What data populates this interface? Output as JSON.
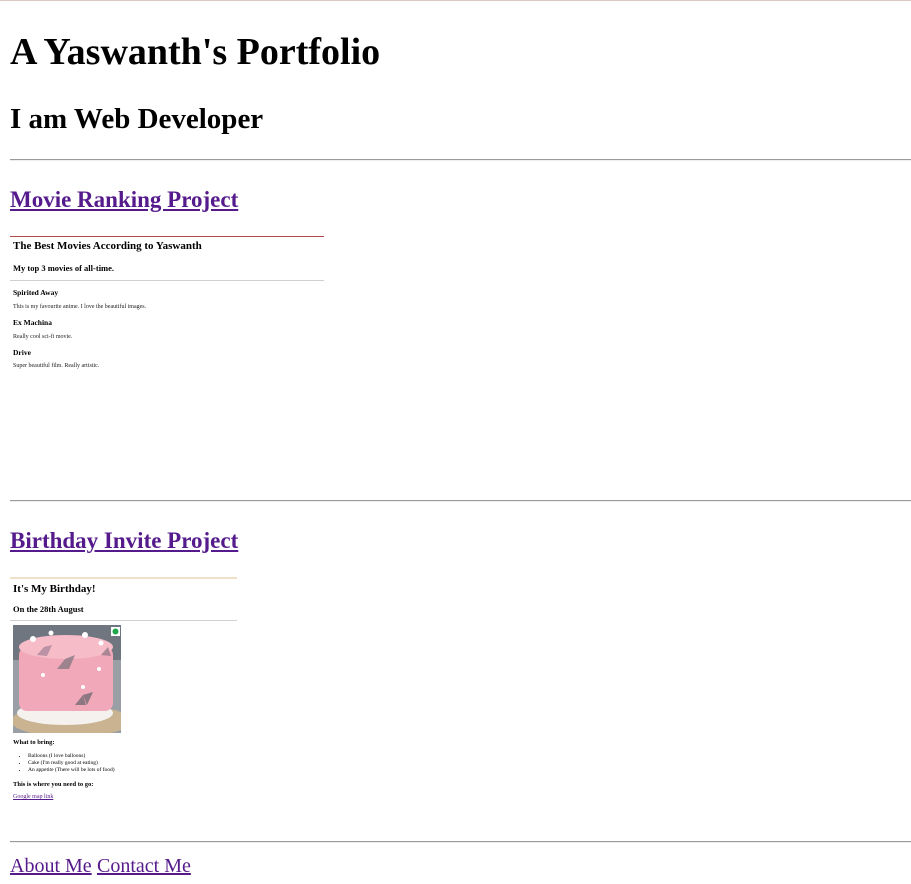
{
  "header": {
    "title": "A Yaswanth's Portfolio",
    "subtitle": "I am Web Developer"
  },
  "projects": [
    {
      "link_label": "Movie Ranking Project",
      "preview": {
        "title": "The Best Movies According to Yaswanth",
        "subtitle": "My top 3 movies of all-time.",
        "movies": [
          {
            "name": "Spirited Away",
            "description": "This is my favourite anime. I love the beautiful images."
          },
          {
            "name": "Ex Machina",
            "description": "Really cool sci-fi movie."
          },
          {
            "name": "Drive",
            "description": "Super beautiful film. Really artistic."
          }
        ]
      }
    },
    {
      "link_label": "Birthday Invite Project",
      "preview": {
        "title": "It's My Birthday!",
        "subtitle": "On the 28th August",
        "bring_heading": "What to bring:",
        "bring_items": [
          "Balloons (I love balloons)",
          "Cake (I'm really good at eating)",
          "An appetite (There will be lots of food)"
        ],
        "location_heading": "This is where you need to go:",
        "map_link": "Google map link"
      }
    }
  ],
  "footer": {
    "about_label": "About Me",
    "contact_label": "Contact Me"
  },
  "colors": {
    "link": "#551a8b",
    "cake_pink": "#f2a9b8"
  }
}
